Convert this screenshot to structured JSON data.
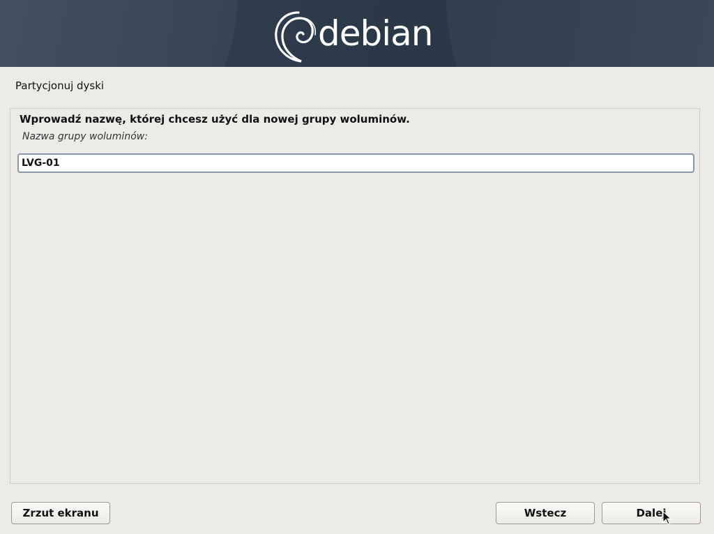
{
  "banner": {
    "logo_text": "debian",
    "logo_icon": "debian-swirl-icon"
  },
  "page": {
    "title": "Partycjonuj dyski"
  },
  "form": {
    "question": "Wprowadź nazwę, której chcesz użyć dla nowej grupy woluminów.",
    "field_label": "Nazwa grupy woluminów:",
    "field_value": "LVG-01"
  },
  "buttons": {
    "screenshot": "Zrzut ekranu",
    "back": "Wstecz",
    "next": "Dalej"
  },
  "colors": {
    "banner": "#2e3c4d",
    "background": "#edebe7",
    "input_border": "#8a98a8"
  }
}
